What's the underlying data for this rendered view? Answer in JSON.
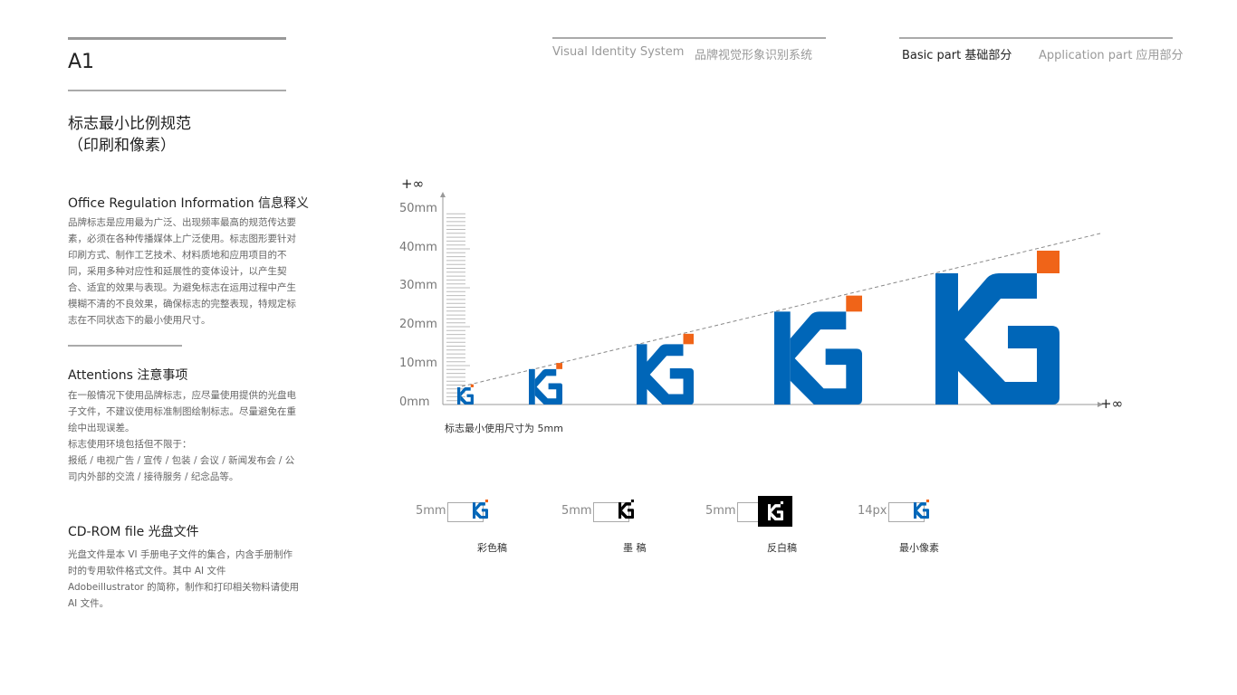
{
  "page_code": "A1",
  "header": {
    "vis_en": "Visual Identity System",
    "vis_cn": "品牌视觉形象识别系统",
    "basic": "Basic part  基础部分",
    "application": "Application part  应用部分"
  },
  "title": {
    "line1": "标志最小比例规范",
    "line2": "（印刷和像素）"
  },
  "sections": [
    {
      "heading": "Office Regulation Information 信息释义",
      "body": "品牌标志是应用最为广泛、出现频率最高的规范传达要素，必须在各种传播媒体上广泛使用。标志图形要针对印刷方式、制作工艺技术、材料质地和应用项目的不同，采用多种对应性和延展性的变体设计，以产生契合、适宜的效果与表现。为避免标志在运用过程中产生模糊不清的不良效果，确保标志的完整表现，特规定标志在不同状态下的最小使用尺寸。"
    },
    {
      "heading": "Attentions 注意事项",
      "body": "在一般情况下使用品牌标志，应尽量使用提供的光盘电子文件，不建议使用标准制图绘制标志。尽量避免在重绘中出现误差。",
      "body2": "标志使用环境包括但不限于：",
      "body3": "报纸 / 电视广告 / 宣传 / 包装 / 会议 / 新闻发布会 / 公司内外部的交流 / 接待服务 / 纪念品等。"
    },
    {
      "heading": "CD-ROM file 光盘文件",
      "body": "光盘文件是本 VI 手册电子文件的集合，内含手册制作时的专用软件格式文件。其中 AI 文件 Adobeillustrator 的简称，制作和打印相关物料请使用 AI 文件。"
    }
  ],
  "scale": {
    "y_infinity": "+∞",
    "x_infinity": "+∞",
    "ticks": [
      "0mm",
      "10mm",
      "20mm",
      "30mm",
      "40mm",
      "50mm"
    ],
    "note": "标志最小使用尺寸为 5mm"
  },
  "variants": [
    {
      "size": "5mm",
      "label": "彩色稿",
      "style": "color"
    },
    {
      "size": "5mm",
      "label": "墨 稿",
      "style": "black"
    },
    {
      "size": "5mm",
      "label": "反白稿",
      "style": "reverse"
    },
    {
      "size": "14px",
      "label": "最小像素",
      "style": "color"
    }
  ],
  "colors": {
    "brand_blue": "#0066b8",
    "brand_orange": "#f06418"
  }
}
